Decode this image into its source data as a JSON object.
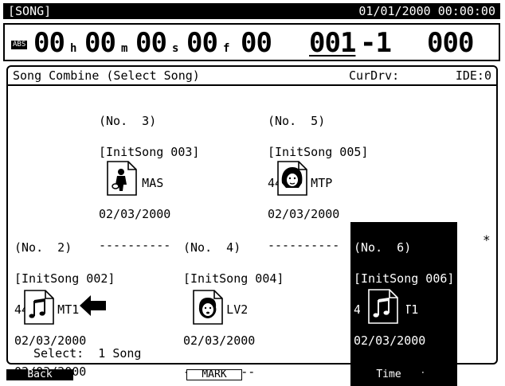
{
  "status_bar": {
    "mode": "[SONG]",
    "datetime": "01/01/2000  00:00:00"
  },
  "counter": {
    "abs_badge": "ABS",
    "hours": "00",
    "hours_unit": "h",
    "minutes": "00",
    "minutes_unit": "m",
    "seconds": "00",
    "seconds_unit": "s",
    "frames": "00",
    "frames_unit": "f",
    "subframe": "00",
    "measure": "001",
    "beat_sep": "-1",
    "tick": "000"
  },
  "screen": {
    "title": "Song Combine (Select Song)",
    "cur_drv_label": "CurDrv:",
    "cur_drv_value": "IDE:0"
  },
  "songs": [
    {
      "no": "(No.  3)",
      "name": "[InitSong 003]",
      "rate": "  48k MAS",
      "date1": "02/03/2000",
      "date2": "----------",
      "icon": "guitar-player-song-icon"
    },
    {
      "no": "(No.  5)",
      "name": "[InitSong 005]",
      "rate": "44.1k MTP",
      "date1": "02/03/2000",
      "date2": "----------",
      "icon": "face-song-icon"
    },
    {
      "no": "(No.  2)",
      "name": "[InitSong 002]",
      "rate": "44.1k MT1",
      "date1": "02/03/2000",
      "date2": "02/03/2000",
      "icon": "music-note-song-icon"
    },
    {
      "no": "(No.  4)",
      "name": "[InitSong 004]",
      "rate": "  32k LV2",
      "date1": "02/03/2000",
      "date2": "----------",
      "icon": "singer-face-song-icon"
    },
    {
      "no": "(No.  6)",
      "name": "[InitSong 006]",
      "rate": "44.1k MT1",
      "date1": "02/03/2000",
      "date2": "----------",
      "icon": "music-note-song-icon",
      "selected_mark": "*"
    }
  ],
  "selection": {
    "label": "Select:",
    "count": "1 Song"
  },
  "softkeys": {
    "f1": "Back",
    "f3": "MARK",
    "f5": "Time"
  }
}
